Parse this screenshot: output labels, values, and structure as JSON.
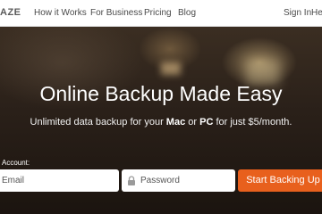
{
  "header": {
    "logo_text": "AZE",
    "nav": {
      "how_it_works": "How it Works",
      "for_business": "For Business",
      "pricing": "Pricing",
      "blog": "Blog",
      "sign_in": "Sign In",
      "help_partial": "He"
    }
  },
  "hero": {
    "headline": "Online Backup Made Easy",
    "subline_prefix": "Unlimited data backup for your ",
    "mac": "Mac",
    "or": " or ",
    "pc": "PC",
    "subline_suffix": " for just $5/month."
  },
  "signup": {
    "account_label": "Account:",
    "email_placeholder": "Email",
    "password_placeholder": "Password",
    "button_label": "Start Backing Up"
  },
  "icons": {
    "password_field": "lock-icon"
  },
  "colors": {
    "accent": "#e8601d",
    "header_bg": "#ffffff",
    "hero_bg": "#2a2019",
    "text_light": "#ffffff"
  }
}
